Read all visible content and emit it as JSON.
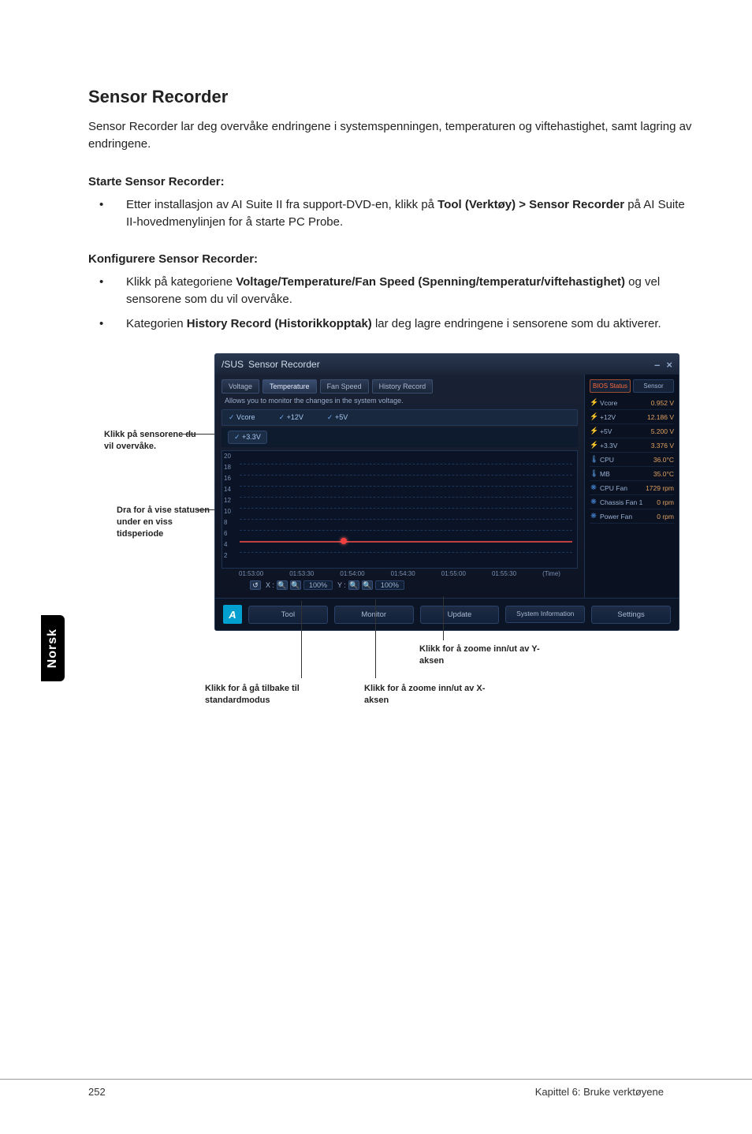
{
  "side_tab": "Norsk",
  "heading": "Sensor Recorder",
  "intro": "Sensor Recorder lar deg overvåke endringene i systemspenningen, temperaturen og viftehastighet, samt lagring av endringene.",
  "start": {
    "heading": "Starte Sensor Recorder:",
    "b1_pre": "Etter installasjon av AI Suite II fra support-DVD-en, klikk på ",
    "b1_strong": "Tool (Verktøy) > Sensor Recorder",
    "b1_post": " på AI Suite II-hovedmenylinjen for å starte PC Probe."
  },
  "config": {
    "heading": "Konfigurere Sensor Recorder:",
    "b1_pre": "Klikk på kategoriene ",
    "b1_strong": "Voltage/Temperature/Fan Speed (Spenning/temperatur/viftehastighet)",
    "b1_post": " og vel sensorene som du vil overvåke.",
    "b2_pre": "Kategorien ",
    "b2_strong": "History Record (Historikkopptak)",
    "b2_post": " lar deg lagre endringene i sensorene som du aktiverer."
  },
  "callouts": {
    "left1": "Klikk på sensorene du vil overvåke.",
    "left2": "Dra for å vise statusen under en viss tidsperiode",
    "bottomA": "Klikk for å zoome inn/ut av Y-aksen",
    "bottomB": "Klikk for å zoome inn/ut av X-aksen",
    "bottomC": "Klikk for å gå tilbake til standardmodus"
  },
  "app": {
    "titlebar_brand": "/SUS",
    "titlebar_name": "Sensor Recorder",
    "close": "×",
    "min": "–",
    "tabs": {
      "voltage": "Voltage",
      "temperature": "Temperature",
      "fanspeed": "Fan Speed",
      "history": "History Record"
    },
    "desc": "Allows you to monitor the changes in the system voltage.",
    "sensors": {
      "vcore": "Vcore",
      "p12v": "+12V",
      "p5v": "+5V"
    },
    "chip": "+3.3V",
    "yticks": [
      "20",
      "18",
      "16",
      "14",
      "12",
      "10",
      "8",
      "6",
      "4",
      "2"
    ],
    "xticks": [
      "01:53:00",
      "01:53:30",
      "01:54:00",
      "01:54:30",
      "01:55:00",
      "01:55:30"
    ],
    "xtime_label": "(Time)",
    "zoom": {
      "x_label": "X :",
      "x_val": "100%",
      "y_label": "Y :",
      "y_val": "100%"
    },
    "side": {
      "tab_status": "BIOS Status",
      "tab_sensor": "Sensor",
      "rows": [
        {
          "icon": "⚡",
          "label": "Vcore",
          "value": "0.952 V"
        },
        {
          "icon": "⚡",
          "label": "+12V",
          "value": "12.186 V"
        },
        {
          "icon": "⚡",
          "label": "+5V",
          "value": "5.200 V"
        },
        {
          "icon": "⚡",
          "label": "+3.3V",
          "value": "3.376 V"
        },
        {
          "icon": "🌡",
          "label": "CPU",
          "value": "36.0°C"
        },
        {
          "icon": "🌡",
          "label": "MB",
          "value": "35.0°C"
        },
        {
          "icon": "❋",
          "label": "CPU Fan",
          "value": "1729 rpm"
        },
        {
          "icon": "❋",
          "label": "Chassis Fan 1",
          "value": "0 rpm"
        },
        {
          "icon": "❋",
          "label": "Power Fan",
          "value": "0 rpm"
        }
      ]
    },
    "bottom": {
      "tool": "Tool",
      "monitor": "Monitor",
      "update": "Update",
      "sysinfo": "System Information",
      "settings": "Settings"
    }
  },
  "footer": {
    "page": "252",
    "chapter": "Kapittel 6: Bruke verktøyene"
  },
  "chart_data": {
    "type": "line",
    "title": "Sensor Recorder voltage monitor",
    "xlabel": "(Time)",
    "ylabel": "",
    "ylim": [
      0,
      20
    ],
    "x": [
      "01:53:00",
      "01:53:30",
      "01:54:00",
      "01:54:30",
      "01:55:00",
      "01:55:30"
    ],
    "series": [
      {
        "name": "+3.3V",
        "values": [
          3.3,
          3.3,
          3.3,
          3.3,
          3.3,
          3.3
        ]
      }
    ]
  }
}
